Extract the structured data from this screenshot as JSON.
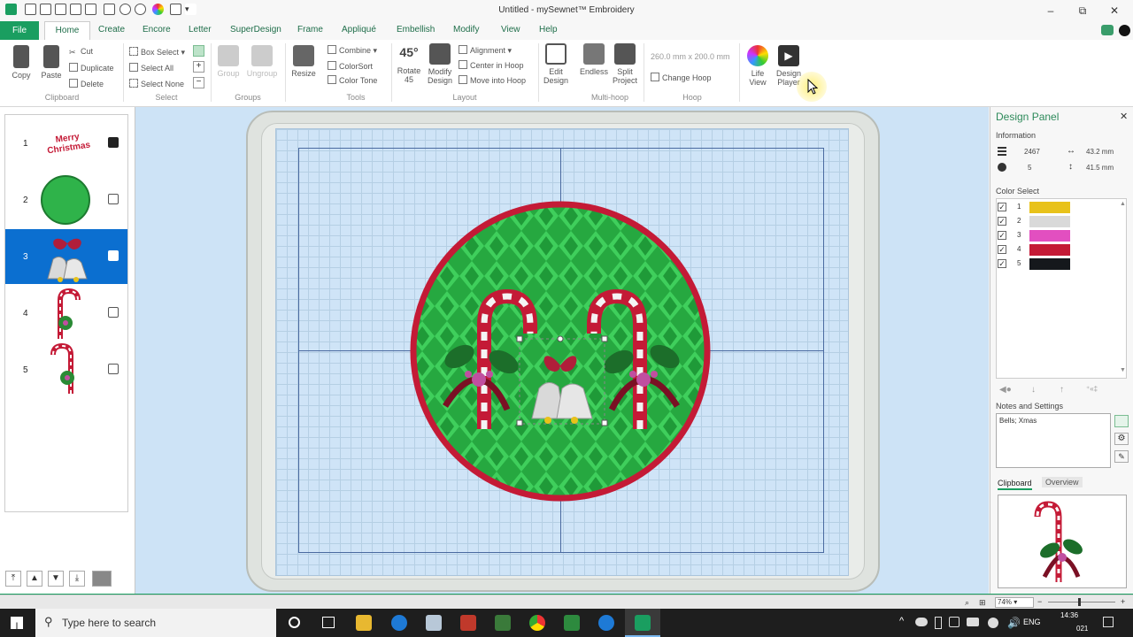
{
  "window": {
    "title": "Untitled - mySewnet™ Embroidery",
    "minimize": "–",
    "restore": "⧉",
    "close": "✕"
  },
  "tabs": [
    "File",
    "Home",
    "Create",
    "Encore",
    "Letter",
    "SuperDesign",
    "Frame",
    "Appliqué",
    "Embellish",
    "Modify",
    "View",
    "Help"
  ],
  "ribbon": {
    "clipboard": {
      "copy": "Copy",
      "paste": "Paste",
      "cut": "Cut",
      "duplicate": "Duplicate",
      "delete": "Delete",
      "group": "Clipboard"
    },
    "select": {
      "box_select": "Box Select",
      "select_all": "Select All",
      "select_none": "Select None",
      "group": "Select"
    },
    "groups": {
      "group": "Group",
      "ungroup": "Ungroup",
      "group_label": "Groups"
    },
    "tools": {
      "resize": "Resize",
      "combine": "Combine",
      "colorsort": "ColorSort",
      "colortone": "Color Tone",
      "group": "Tools"
    },
    "layout": {
      "rotate": "Rotate",
      "rotate_angle": "45",
      "rotate_big": "45°",
      "modify": "Modify",
      "modify2": "Design",
      "alignment": "Alignment",
      "center": "Center in Hoop",
      "move": "Move into Hoop",
      "group": "Layout"
    },
    "multihoop": {
      "edit": "Edit",
      "edit2": "Design",
      "endless": "Endless",
      "split": "Split",
      "split2": "Project",
      "group": "Multi-hoop"
    },
    "hoop": {
      "size": "260.0 mm x 200.0 mm",
      "change": "Change Hoop",
      "group": "Hoop"
    },
    "life": {
      "life": "Life",
      "life2": "View",
      "player": "Design",
      "player2": "Player"
    }
  },
  "layers": [
    {
      "num": "1",
      "name": "Merry Christmas"
    },
    {
      "num": "2"
    },
    {
      "num": "3"
    },
    {
      "num": "4"
    },
    {
      "num": "5"
    }
  ],
  "design_panel": {
    "title": "Design Panel",
    "information_label": "Information",
    "stitches": "2467",
    "colors": "5",
    "width": "43.2 mm",
    "height": "41.5 mm",
    "color_select_label": "Color Select",
    "colors_list": [
      {
        "num": "1",
        "hex": "#e8c21a"
      },
      {
        "num": "2",
        "hex": "#d9d9d9"
      },
      {
        "num": "3",
        "hex": "#e24fc0"
      },
      {
        "num": "4",
        "hex": "#c41a36"
      },
      {
        "num": "5",
        "hex": "#15181c"
      }
    ],
    "notes_label": "Notes and Settings",
    "notes_value": "Bells; Xmas",
    "clipboard_tab": "Clipboard",
    "overview_tab": "Overview"
  },
  "status": {
    "zoom": "74%"
  },
  "taskbar": {
    "search_placeholder": "Type here to search",
    "time": "14:36",
    "date": "021",
    "lang": "ENG"
  }
}
